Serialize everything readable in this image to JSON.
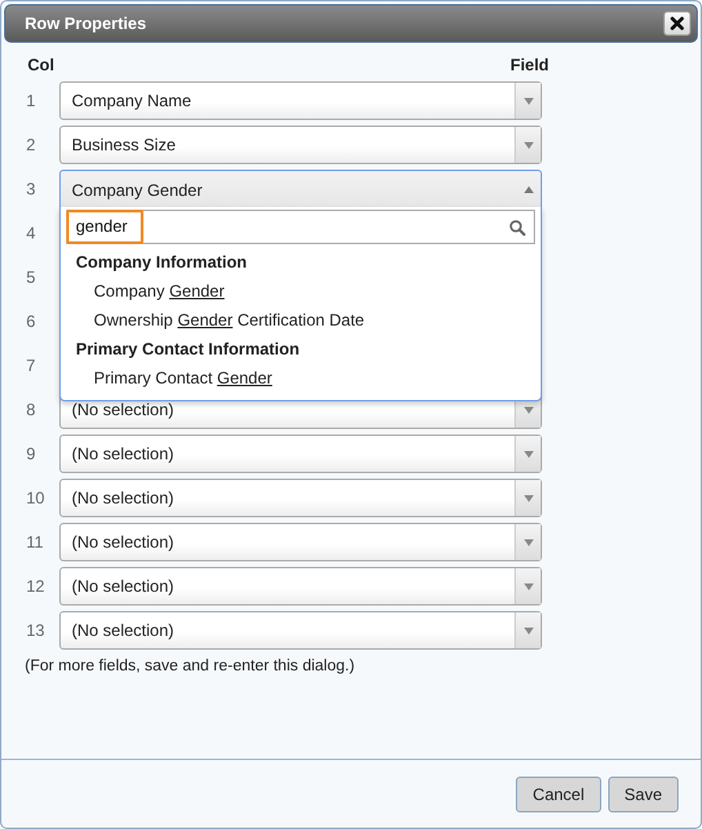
{
  "dialog": {
    "title": "Row Properties"
  },
  "headers": {
    "col": "Col",
    "field": "Field"
  },
  "rows": [
    {
      "col": "1",
      "value": "Company Name",
      "expanded": false
    },
    {
      "col": "2",
      "value": "Business Size",
      "expanded": false
    },
    {
      "col": "3",
      "value": "Company Gender",
      "expanded": true
    },
    {
      "col": "4"
    },
    {
      "col": "5"
    },
    {
      "col": "6"
    },
    {
      "col": "7"
    },
    {
      "col": "8",
      "value": "(No selection)",
      "expanded": false
    },
    {
      "col": "9",
      "value": "(No selection)",
      "expanded": false
    },
    {
      "col": "10",
      "value": "(No selection)",
      "expanded": false
    },
    {
      "col": "11",
      "value": "(No selection)",
      "expanded": false
    },
    {
      "col": "12",
      "value": "(No selection)",
      "expanded": false
    },
    {
      "col": "13",
      "value": "(No selection)",
      "expanded": false
    }
  ],
  "dropdown": {
    "search": {
      "value": "gender"
    },
    "groups": [
      {
        "label": "Company Information",
        "options": [
          {
            "text_before": "Company ",
            "highlight": "Gender"
          },
          {
            "text_before": "Ownership ",
            "highlight": "Gender",
            "text_after": " Certification Date"
          }
        ]
      },
      {
        "label": "Primary Contact Information",
        "options": [
          {
            "text_before": "Primary Contact ",
            "highlight": "Gender"
          }
        ]
      }
    ]
  },
  "note": "(For more fields, save and re-enter this dialog.)",
  "buttons": [
    {
      "label": "Cancel"
    },
    {
      "label": "Save"
    }
  ]
}
